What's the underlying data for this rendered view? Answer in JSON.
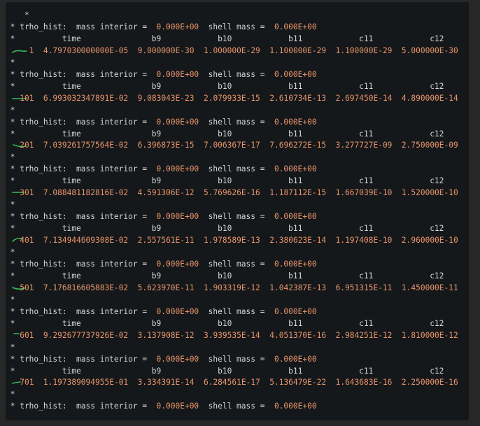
{
  "colors": {
    "page_background": "#272727",
    "terminal_background": "#15181b",
    "text": "#d6d6d6",
    "number": "#e9956a",
    "annotation": "#3bb75a"
  },
  "lines": [
    {
      "type": "star",
      "text": "    *"
    },
    {
      "type": "header",
      "prefix": " * trho_hist:  mass interior =  ",
      "mass_interior": "0.000E+00",
      "middle": "  shell mass =  ",
      "shell_mass": "0.000E+00"
    },
    {
      "type": "columns",
      "text": " *          time               b9            b10            b11            c11            c12"
    },
    {
      "type": "data",
      "lead": "     ",
      "step": "1",
      "values": [
        "4.797030000000E-05",
        "9.000000E-30",
        "1.000000E-29",
        "1.100000E-29",
        "1.100000E-29",
        "5.000000E-30"
      ]
    },
    {
      "type": "star",
      "text": " *"
    },
    {
      "type": "header",
      "prefix": " * trho_hist:  mass interior =  ",
      "mass_interior": "0.000E+00",
      "middle": "  shell mass =  ",
      "shell_mass": "0.000E+00"
    },
    {
      "type": "columns",
      "text": " *          time               b9            b10            b11            c11            c12"
    },
    {
      "type": "data",
      "lead": "   ",
      "step": "101",
      "values": [
        "6.993032347891E-02",
        "9.083043E-23",
        "2.079933E-15",
        "2.610734E-13",
        "2.697450E-14",
        "4.890000E-14"
      ]
    },
    {
      "type": "star",
      "text": " *"
    },
    {
      "type": "header",
      "prefix": " * trho_hist:  mass interior =  ",
      "mass_interior": "0.000E+00",
      "middle": "  shell mass =  ",
      "shell_mass": "0.000E+00"
    },
    {
      "type": "columns",
      "text": " *          time               b9            b10            b11            c11            c12"
    },
    {
      "type": "data",
      "lead": "   ",
      "step": "201",
      "values": [
        "7.039261757564E-02",
        "6.396873E-15",
        "7.006367E-17",
        "7.696272E-15",
        "3.277727E-09",
        "2.750000E-09"
      ]
    },
    {
      "type": "star",
      "text": " *"
    },
    {
      "type": "header",
      "prefix": " * trho_hist:  mass interior =  ",
      "mass_interior": "0.000E+00",
      "middle": "  shell mass =  ",
      "shell_mass": "0.000E+00"
    },
    {
      "type": "columns",
      "text": " *          time               b9            b10            b11            c11            c12"
    },
    {
      "type": "data",
      "lead": "   ",
      "step": "301",
      "values": [
        "7.088481182816E-02",
        "4.591306E-12",
        "5.769626E-16",
        "1.187112E-15",
        "1.667039E-10",
        "1.520000E-10"
      ]
    },
    {
      "type": "star",
      "text": " *"
    },
    {
      "type": "header",
      "prefix": " * trho_hist:  mass interior =  ",
      "mass_interior": "0.000E+00",
      "middle": "  shell mass =  ",
      "shell_mass": "0.000E+00"
    },
    {
      "type": "columns",
      "text": " *          time               b9            b10            b11            c11            c12"
    },
    {
      "type": "data",
      "lead": "   ",
      "step": "401",
      "values": [
        "7.134944609308E-02",
        "2.557561E-11",
        "1.978589E-13",
        "2.380623E-14",
        "1.197408E-10",
        "2.960000E-10"
      ]
    },
    {
      "type": "star",
      "text": " *"
    },
    {
      "type": "header",
      "prefix": " * trho_hist:  mass interior =  ",
      "mass_interior": "0.000E+00",
      "middle": "  shell mass =  ",
      "shell_mass": "0.000E+00"
    },
    {
      "type": "columns",
      "text": " *          time               b9            b10            b11            c11            c12"
    },
    {
      "type": "data",
      "lead": "   ",
      "step": "501",
      "values": [
        "7.176816605883E-02",
        "5.623970E-11",
        "1.903319E-12",
        "1.042387E-13",
        "6.951315E-11",
        "1.450000E-11"
      ]
    },
    {
      "type": "star",
      "text": " *"
    },
    {
      "type": "header",
      "prefix": " * trho_hist:  mass interior =  ",
      "mass_interior": "0.000E+00",
      "middle": "  shell mass =  ",
      "shell_mass": "0.000E+00"
    },
    {
      "type": "columns",
      "text": " *          time               b9            b10            b11            c11            c12"
    },
    {
      "type": "data",
      "lead": "   ",
      "step": "601",
      "values": [
        "9.292677737926E-02",
        "3.137908E-12",
        "3.939535E-14",
        "4.051370E-16",
        "2.984251E-12",
        "1.810000E-12"
      ]
    },
    {
      "type": "star",
      "text": " *"
    },
    {
      "type": "header",
      "prefix": " * trho_hist:  mass interior =  ",
      "mass_interior": "0.000E+00",
      "middle": "  shell mass =  ",
      "shell_mass": "0.000E+00"
    },
    {
      "type": "columns",
      "text": " *          time               b9            b10            b11            c11            c12"
    },
    {
      "type": "data",
      "lead": "   ",
      "step": "701",
      "values": [
        "1.197389094955E-01",
        "3.334391E-14",
        "6.284561E-17",
        "5.136479E-22",
        "1.643683E-16",
        "2.250000E-16"
      ]
    },
    {
      "type": "star",
      "text": " *"
    },
    {
      "type": "header",
      "prefix": " * trho_hist:  mass interior =  ",
      "mass_interior": "0.000E+00",
      "middle": "  shell mass =  ",
      "shell_mass": "0.000E+00"
    }
  ]
}
